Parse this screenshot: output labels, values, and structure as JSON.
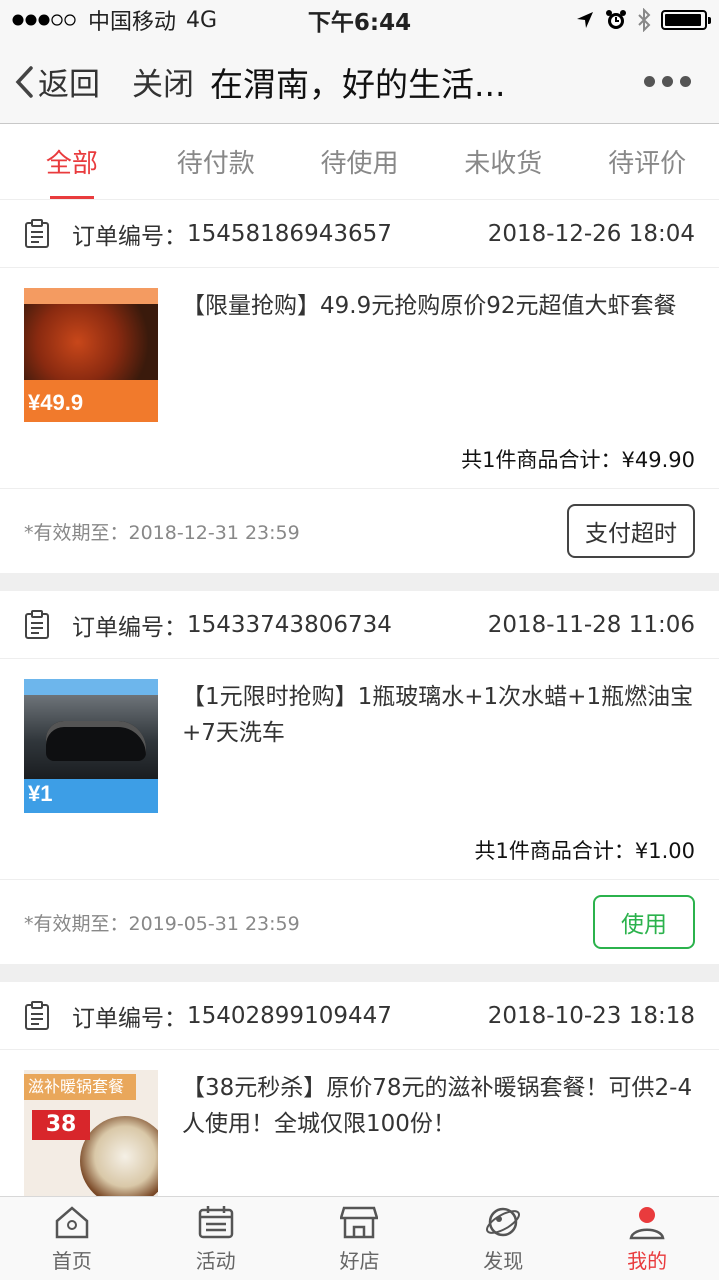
{
  "status_bar": {
    "carrier": "中国移动",
    "network": "4G",
    "time": "下午6:44"
  },
  "nav": {
    "back_label": "返回",
    "close_label": "关闭",
    "title": "在渭南，好的生活..."
  },
  "tabs": [
    {
      "label": "全部",
      "active": true
    },
    {
      "label": "待付款",
      "active": false
    },
    {
      "label": "待使用",
      "active": false
    },
    {
      "label": "未收货",
      "active": false
    },
    {
      "label": "待评价",
      "active": false
    }
  ],
  "orders": [
    {
      "number_label": "订单编号：",
      "number": "15458186943657",
      "datetime": "2018-12-26 18:04",
      "price_badge": "¥49.9",
      "description": "【限量抢购】49.9元抢购原价92元超值大虾套餐",
      "total": "共1件商品合计：¥49.90",
      "validity": "*有效期至：2018-12-31 23:59",
      "action": "支付超时"
    },
    {
      "number_label": "订单编号：",
      "number": "15433743806734",
      "datetime": "2018-11-28 11:06",
      "price_badge": "¥1",
      "description": "【1元限时抢购】1瓶玻璃水+1次水蜡+1瓶燃油宝+7天洗车",
      "total": "共1件商品合计：¥1.00",
      "validity": "*有效期至：2019-05-31 23:59",
      "action": "使用"
    },
    {
      "number_label": "订单编号：",
      "number": "15402899109447",
      "datetime": "2018-10-23 18:18",
      "tag": "滋补暖锅套餐",
      "price_badge": "38",
      "description": "【38元秒杀】原价78元的滋补暖锅套餐！可供2-4人使用！全城仅限100份！"
    }
  ],
  "bottom_nav": [
    {
      "label": "首页",
      "icon": "home-icon",
      "active": false
    },
    {
      "label": "活动",
      "icon": "calendar-icon",
      "active": false
    },
    {
      "label": "好店",
      "icon": "store-icon",
      "active": false
    },
    {
      "label": "发现",
      "icon": "planet-icon",
      "active": false
    },
    {
      "label": "我的",
      "icon": "user-icon",
      "active": true
    }
  ],
  "colors": {
    "accent": "#e93b3d",
    "use_green": "#2bb24c"
  }
}
